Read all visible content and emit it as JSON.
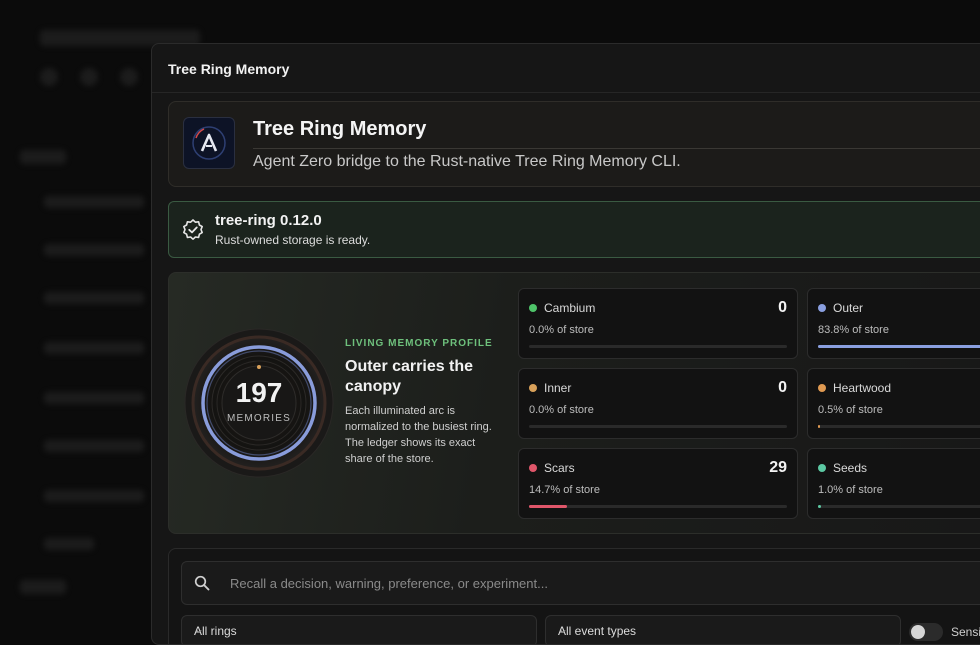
{
  "modal": {
    "title": "Tree Ring Memory"
  },
  "header": {
    "title": "Tree Ring Memory",
    "description": "Agent Zero bridge to the Rust-native Tree Ring Memory CLI.",
    "logo_icon": "agent-zero-logo"
  },
  "status": {
    "title": "tree-ring 0.12.0",
    "message": "Rust-owned storage is ready.",
    "icon": "verified-badge-icon"
  },
  "profile": {
    "count": "197",
    "count_label": "MEMORIES",
    "kicker": "LIVING MEMORY PROFILE",
    "heading": "Outer carries the canopy",
    "body": "Each illuminated arc is normalized to the busiest ring. The ledger shows its exact share of the store."
  },
  "rings": [
    {
      "name": "Cambium",
      "count": "0",
      "share": "0.0% of store",
      "fraction": 0.0,
      "color": "#4fc46a"
    },
    {
      "name": "Outer",
      "count": "",
      "share": "83.8% of store",
      "fraction": 0.838,
      "color": "#8a9fe0"
    },
    {
      "name": "Inner",
      "count": "0",
      "share": "0.0% of store",
      "fraction": 0.0,
      "color": "#d9a15a"
    },
    {
      "name": "Heartwood",
      "count": "",
      "share": "0.5% of store",
      "fraction": 0.005,
      "color": "#e09a52"
    },
    {
      "name": "Scars",
      "count": "29",
      "share": "14.7% of store",
      "fraction": 0.147,
      "color": "#e0566a"
    },
    {
      "name": "Seeds",
      "count": "",
      "share": "1.0% of store",
      "fraction": 0.01,
      "color": "#5cc9a3"
    }
  ],
  "search": {
    "placeholder": "Recall a decision, warning, preference, or experiment...",
    "ring_filter": "All rings",
    "event_filter": "All event types",
    "toggle_label": "Sensi"
  },
  "colors": {
    "accent_green": "#6ec07c",
    "status_border": "#3a5a42"
  }
}
